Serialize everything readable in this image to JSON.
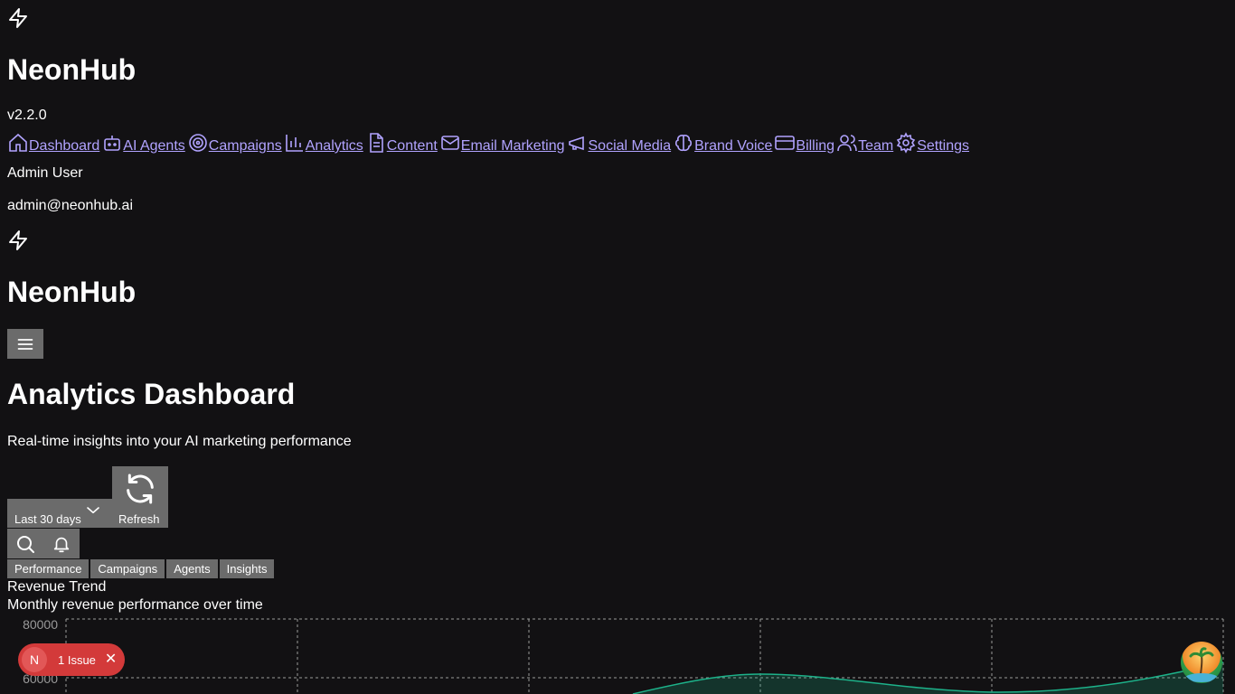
{
  "brand": {
    "name": "NeonHub",
    "version": "v2.2.0"
  },
  "nav": [
    {
      "label": "Dashboard",
      "icon": "home-icon"
    },
    {
      "label": "AI Agents",
      "icon": "bot-icon"
    },
    {
      "label": "Campaigns",
      "icon": "target-icon"
    },
    {
      "label": "Analytics",
      "icon": "bar-chart-icon"
    },
    {
      "label": "Content",
      "icon": "file-text-icon"
    },
    {
      "label": "Email Marketing",
      "icon": "mail-icon"
    },
    {
      "label": "Social Media",
      "icon": "megaphone-icon"
    },
    {
      "label": "Brand Voice",
      "icon": "brain-icon"
    },
    {
      "label": "Billing",
      "icon": "credit-card-icon"
    },
    {
      "label": "Team",
      "icon": "users-icon"
    },
    {
      "label": "Settings",
      "icon": "gear-icon"
    }
  ],
  "user": {
    "name": "Admin User",
    "email": "admin@neonhub.ai"
  },
  "header": {
    "title": "Analytics Dashboard",
    "subtitle": "Real-time insights into your AI marketing performance"
  },
  "controls": {
    "range_label": "Last 30 days",
    "refresh_label": "Refresh"
  },
  "tabs": [
    "Performance",
    "Campaigns",
    "Agents",
    "Insights"
  ],
  "chart_card": {
    "title": "Revenue Trend",
    "subtitle": "Monthly revenue performance over time"
  },
  "chart_data": {
    "type": "area",
    "yticks": [
      "80000",
      "60000"
    ],
    "series_color": "#1db28a"
  },
  "issue_badge": {
    "avatar": "N",
    "text": "1 Issue"
  },
  "colors": {
    "background": "#121113",
    "link": "#b1a3ff",
    "button": "#6b6b6b",
    "issue": "#d33a3a",
    "chart_line": "#1db28a"
  }
}
